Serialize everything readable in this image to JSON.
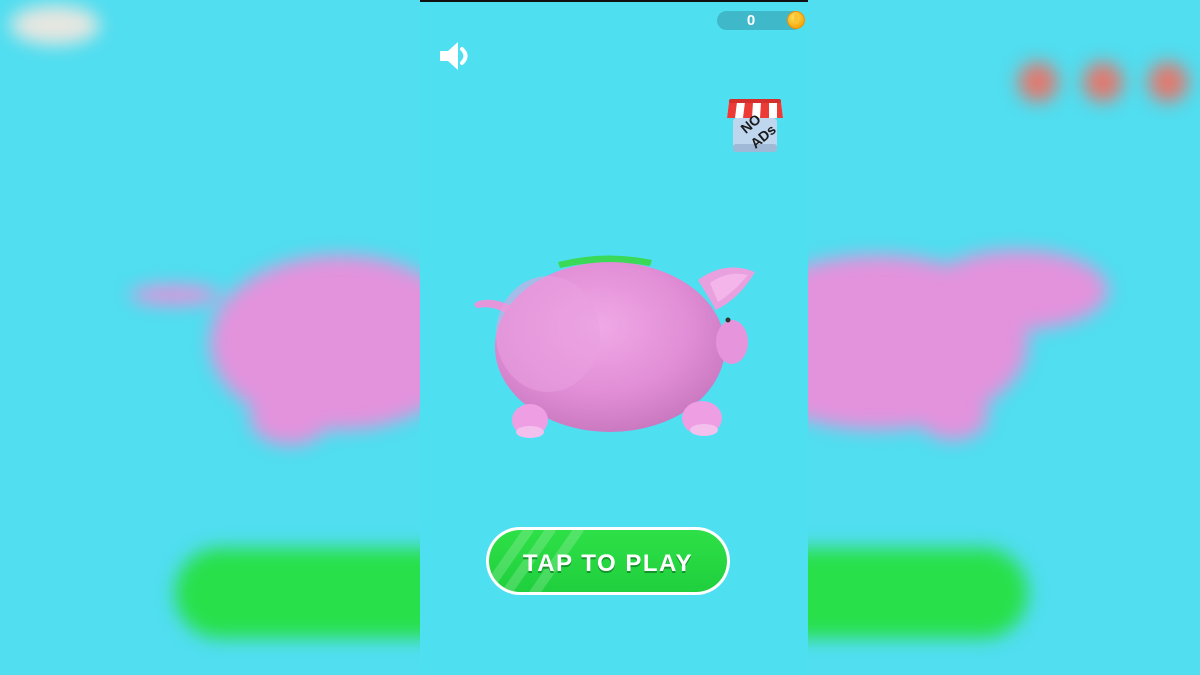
{
  "hud": {
    "coins": "0",
    "coin_icon": "coin-icon",
    "sound_icon": "speaker-icon"
  },
  "shop": {
    "no_ads_line1": "NO",
    "no_ads_line2": "ADs"
  },
  "main": {
    "character": "piggy-bank",
    "play_label": "TAP TO PLAY"
  },
  "colors": {
    "background": "#4ee0f1",
    "play_button": "#27d944",
    "pig": "#e596db",
    "coin": "#f5b71a"
  }
}
